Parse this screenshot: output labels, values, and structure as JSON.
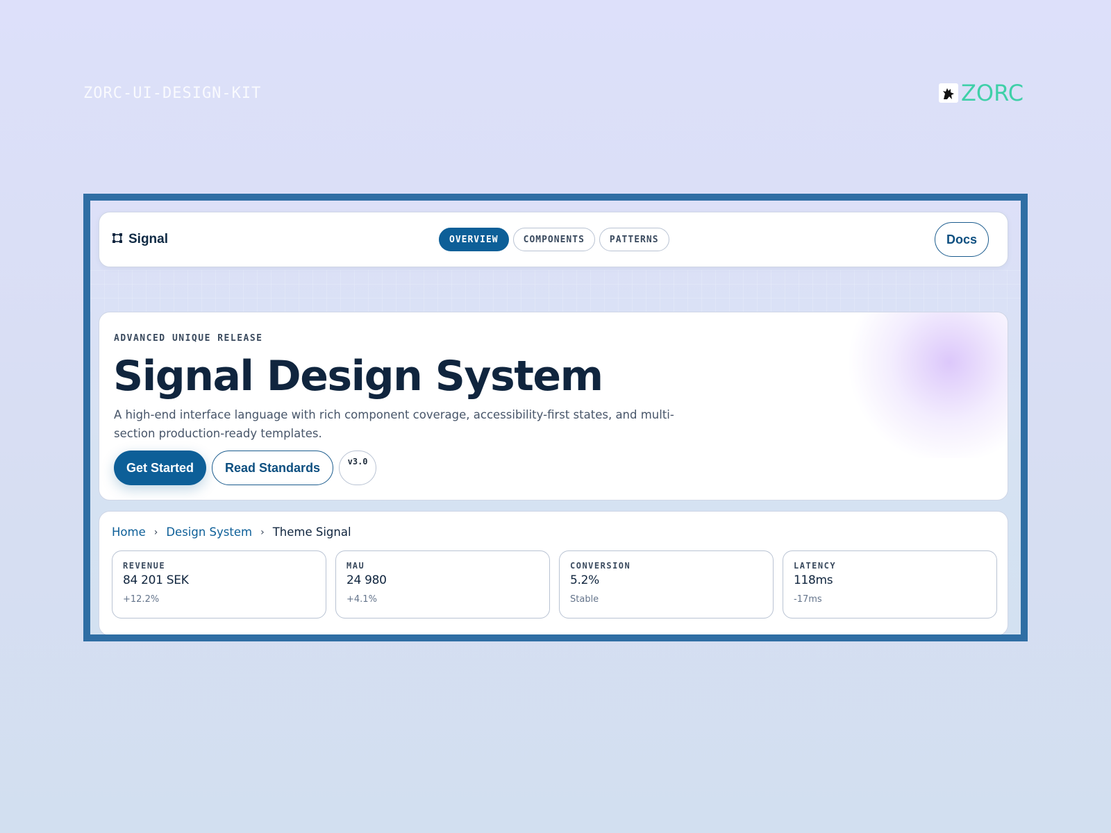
{
  "page": {
    "kit_label": "ZORC-UI-DESIGN-KIT",
    "brand_name": "ZORC",
    "brand_color": "#3fd0a8"
  },
  "navbar": {
    "brand_icon": "frame-icon",
    "brand_name": "Signal",
    "tabs": [
      {
        "label": "OVERVIEW",
        "active": true
      },
      {
        "label": "COMPONENTS",
        "active": false
      },
      {
        "label": "PATTERNS",
        "active": false
      }
    ],
    "docs_label": "Docs"
  },
  "hero": {
    "eyebrow": "ADVANCED UNIQUE RELEASE",
    "title": "Signal Design System",
    "description": "A high-end interface language with rich component coverage, accessibility-first states, and multi-section production-ready templates.",
    "primary_cta": "Get Started",
    "secondary_cta": "Read Standards",
    "version": "v3.0"
  },
  "breadcrumb": {
    "items": [
      "Home",
      "Design System",
      "Theme Signal"
    ]
  },
  "stats": [
    {
      "label": "REVENUE",
      "value": "84 201 SEK",
      "delta": "+12.2%"
    },
    {
      "label": "MAU",
      "value": "24 980",
      "delta": "+4.1%"
    },
    {
      "label": "CONVERSION",
      "value": "5.2%",
      "delta": "Stable"
    },
    {
      "label": "LATENCY",
      "value": "118ms",
      "delta": "-17ms"
    }
  ],
  "colors": {
    "accent": "#0d5f98",
    "frame_border": "#2f6ea4",
    "ink": "#10253e"
  }
}
